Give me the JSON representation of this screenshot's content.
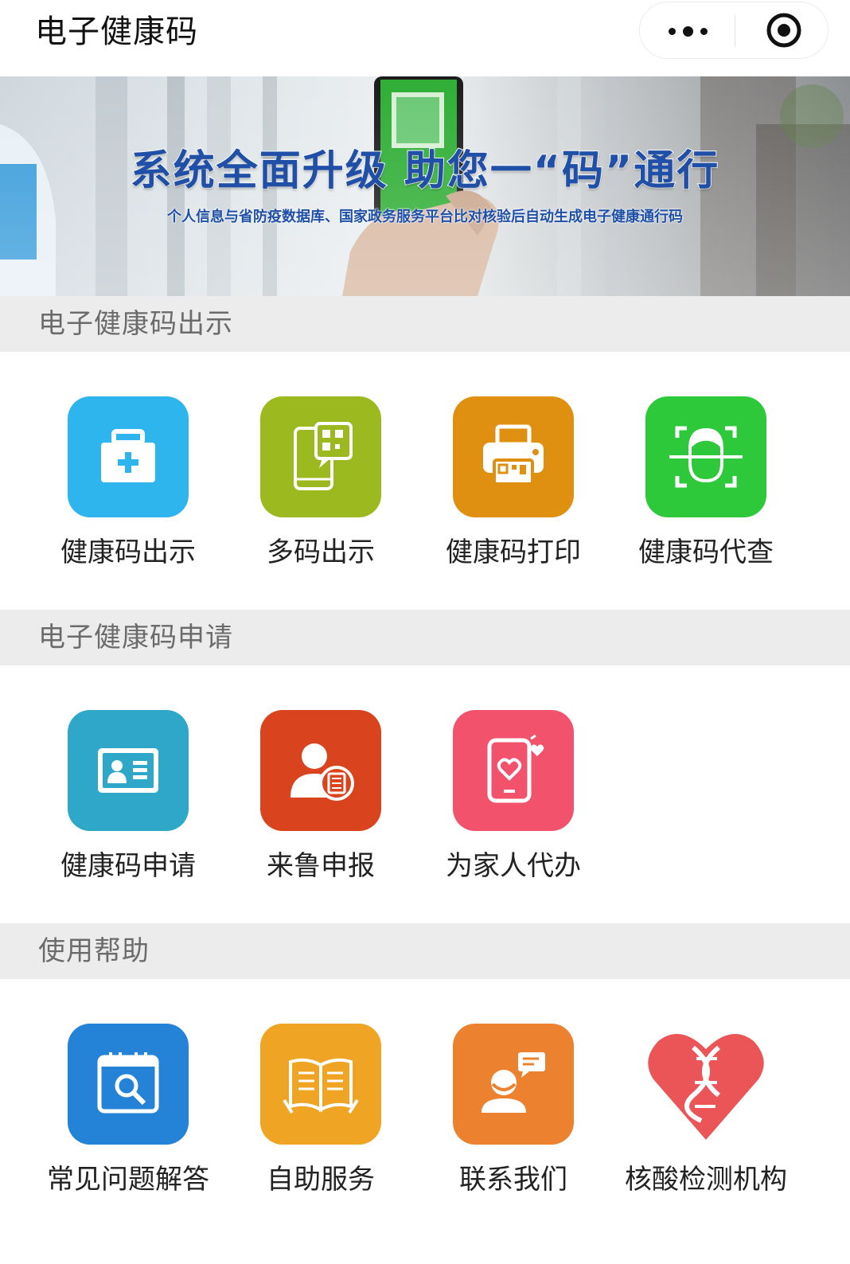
{
  "app": {
    "title": "电子健康码"
  },
  "banner": {
    "title": "系统全面升级 助您一“码”通行",
    "subtitle": "个人信息与省防疫数据库、国家政务服务平台比对核验后自动生成电子健康通行码"
  },
  "sections": [
    {
      "title": "电子健康码出示",
      "items": [
        {
          "label": "健康码出示",
          "icon": "medical-kit-icon",
          "color": "#2fb5ee"
        },
        {
          "label": "多码出示",
          "icon": "phone-qrcode-icon",
          "color": "#9cba1f"
        },
        {
          "label": "健康码打印",
          "icon": "printer-icon",
          "color": "#e09010"
        },
        {
          "label": "健康码代查",
          "icon": "face-scan-icon",
          "color": "#2ec93a"
        }
      ]
    },
    {
      "title": "电子健康码申请",
      "items": [
        {
          "label": "健康码申请",
          "icon": "id-card-icon",
          "color": "#2ea7c9"
        },
        {
          "label": "来鲁申报",
          "icon": "user-report-icon",
          "color": "#d9431e"
        },
        {
          "label": "为家人代办",
          "icon": "phone-heart-icon",
          "color": "#f2526c"
        }
      ]
    },
    {
      "title": "使用帮助",
      "items": [
        {
          "label": "常见问题解答",
          "icon": "calendar-search-icon",
          "color": "#2483d6"
        },
        {
          "label": "自助服务",
          "icon": "open-book-icon",
          "color": "#f0a424"
        },
        {
          "label": "联系我们",
          "icon": "contact-chat-icon",
          "color": "#ec8230"
        },
        {
          "label": "核酸检测机构",
          "icon": "heart-dna-icon",
          "color": "#ec5558"
        }
      ]
    }
  ]
}
